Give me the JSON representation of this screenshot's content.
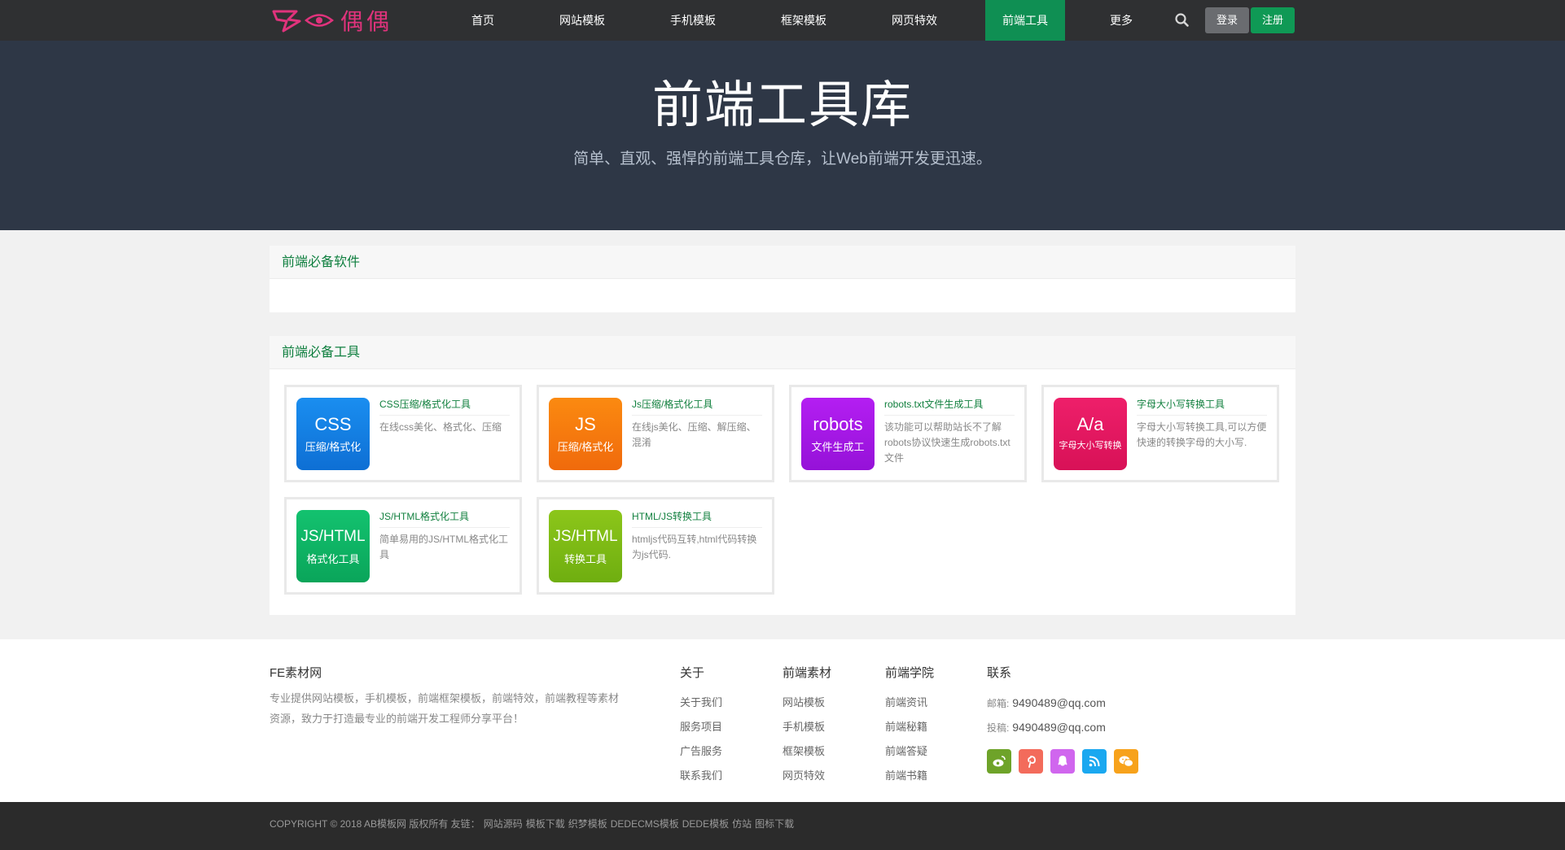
{
  "nav": {
    "logo_text": "偶偶",
    "items": [
      "首页",
      "网站模板",
      "手机模板",
      "框架模板",
      "网页特效",
      "前端工具",
      "更多"
    ],
    "active": "前端工具",
    "login": "登录",
    "register": "注册"
  },
  "hero": {
    "title": "前端工具库",
    "subtitle": "简单、直观、强悍的前端工具仓库，让Web前端开发更迅速。"
  },
  "section1": {
    "title": "前端必备软件"
  },
  "section2": {
    "title": "前端必备工具",
    "tools": [
      {
        "icon_big": "CSS",
        "icon_small": "压缩/格式化",
        "title": "CSS压缩/格式化工具",
        "desc": "在线css美化、格式化、压缩",
        "color_top": "#1a8ef0",
        "color_bottom": "#0e6fd4"
      },
      {
        "icon_big": "JS",
        "icon_small": "压缩/格式化",
        "title": "Js压缩/格式化工具",
        "desc": "在线js美化、压缩、解压缩、混淆",
        "color_top": "#fb8a10",
        "color_bottom": "#f06a0c"
      },
      {
        "icon_big": "robots",
        "icon_small": "文件生成工",
        "title": "robots.txt文件生成工具",
        "desc": "该功能可以帮助站长不了解robots协议快速生成robots.txt文件",
        "color_top": "#b41ef2",
        "color_bottom": "#9512d8"
      },
      {
        "icon_big": "A/a",
        "icon_small": "字母大小写转换",
        "title": "字母大小写转换工具",
        "desc": "字母大小写转换工具,可以方便快速的转换字母的大小写.",
        "color_top": "#ee1f6a",
        "color_bottom": "#d81157"
      },
      {
        "icon_big": "JS/HTML",
        "icon_small": "格式化工具",
        "title": "JS/HTML格式化工具",
        "desc": "简单易用的JS/HTML格式化工具",
        "color_top": "#13c26f",
        "color_bottom": "#0aa55a"
      },
      {
        "icon_big": "JS/HTML",
        "icon_small": "转换工具",
        "title": "HTML/JS转换工具",
        "desc": "htmljs代码互转,html代码转换为js代码.",
        "color_top": "#8cc61a",
        "color_bottom": "#6fae10"
      }
    ]
  },
  "footer": {
    "brand_title": "FE素材网",
    "brand_desc": "专业提供网站模板，手机模板，前端框架模板，前端特效，前端教程等素材资源，致力于打造最专业的前端开发工程师分享平台！",
    "columns": [
      {
        "title": "关于",
        "links": [
          "关于我们",
          "服务项目",
          "广告服务",
          "联系我们"
        ]
      },
      {
        "title": "前端素材",
        "links": [
          "网站模板",
          "手机模板",
          "框架模板",
          "网页特效"
        ]
      },
      {
        "title": "前端学院",
        "links": [
          "前端资讯",
          "前端秘籍",
          "前端答疑",
          "前端书籍"
        ]
      }
    ],
    "contact": {
      "title": "联系",
      "email_label": "邮箱:",
      "email": "9490489@qq.com",
      "submit_label": "投稿:",
      "submit": "9490489@qq.com"
    },
    "social": [
      {
        "name": "weibo-icon",
        "color": "#6ea329"
      },
      {
        "name": "pinterest-icon",
        "color": "#f36b5b"
      },
      {
        "name": "qq-icon",
        "color": "#d066ee"
      },
      {
        "name": "rss-icon",
        "color": "#1aa8f0"
      },
      {
        "name": "wechat-icon",
        "color": "#f7a21b"
      }
    ]
  },
  "bottom": {
    "copyright": "COPYRIGHT © 2018 AB模板网 版权所有 友链：",
    "links": [
      "网站源码",
      "模板下载",
      "织梦模板",
      "DEDECMS模板",
      "DEDE模板",
      "仿站",
      "图标下载"
    ]
  }
}
